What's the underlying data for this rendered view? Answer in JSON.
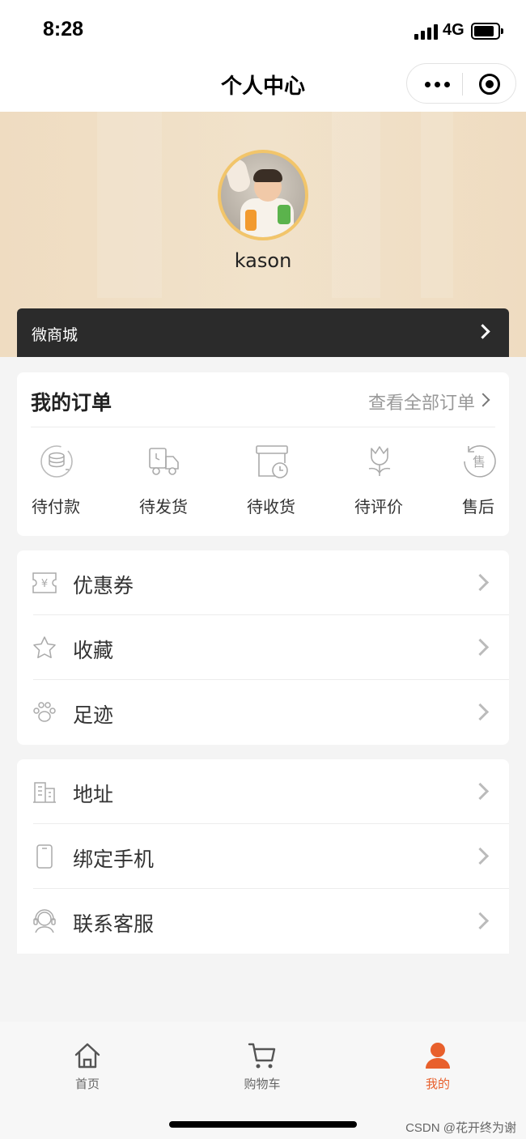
{
  "status_bar": {
    "time": "8:28",
    "network": "4G"
  },
  "nav": {
    "title": "个人中心"
  },
  "profile": {
    "username": "kason",
    "mall_label": "微商城"
  },
  "orders": {
    "title": "我的订单",
    "view_all": "查看全部订单",
    "items": [
      {
        "label": "待付款",
        "icon": "coins-icon"
      },
      {
        "label": "待发货",
        "icon": "delivery-truck-icon"
      },
      {
        "label": "待收货",
        "icon": "package-clock-icon"
      },
      {
        "label": "待评价",
        "icon": "tulip-icon"
      },
      {
        "label": "售后",
        "icon": "after-sale-icon"
      }
    ]
  },
  "menu_group_1": [
    {
      "label": "优惠券",
      "icon": "coupon-icon"
    },
    {
      "label": "收藏",
      "icon": "star-icon"
    },
    {
      "label": "足迹",
      "icon": "paw-icon"
    }
  ],
  "menu_group_2": [
    {
      "label": "地址",
      "icon": "building-icon"
    },
    {
      "label": "绑定手机",
      "icon": "phone-icon"
    },
    {
      "label": "联系客服",
      "icon": "headset-icon"
    }
  ],
  "tabbar": {
    "items": [
      {
        "label": "首页",
        "icon": "home-icon"
      },
      {
        "label": "购物车",
        "icon": "cart-icon"
      },
      {
        "label": "我的",
        "icon": "user-icon",
        "active": true
      }
    ],
    "active_color": "#e8602c"
  },
  "watermark": "CSDN @花开终为谢"
}
